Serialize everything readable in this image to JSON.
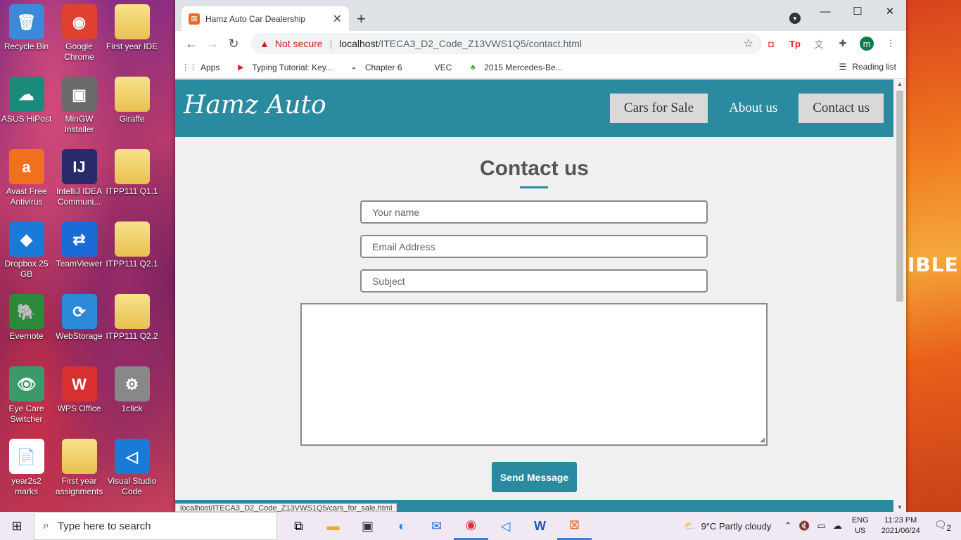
{
  "desktop": {
    "icons": [
      {
        "label": "Recycle Bin",
        "glyph": "🗑"
      },
      {
        "label": "Google Chrome",
        "glyph": "◉"
      },
      {
        "label": "First year IDE",
        "glyph": ""
      },
      {
        "label": "ASUS HiPost",
        "glyph": "☁"
      },
      {
        "label": "MinGW Installer",
        "glyph": "▣"
      },
      {
        "label": "Giraffe",
        "glyph": ""
      },
      {
        "label": "Avast Free Antivirus",
        "glyph": "a"
      },
      {
        "label": "IntelliJ IDEA Communi...",
        "glyph": "IJ"
      },
      {
        "label": "ITPP111 Q1.1",
        "glyph": ""
      },
      {
        "label": "Dropbox 25 GB",
        "glyph": "◆"
      },
      {
        "label": "TeamViewer",
        "glyph": "⇄"
      },
      {
        "label": "ITPP111 Q2.1",
        "glyph": ""
      },
      {
        "label": "Evernote",
        "glyph": "🐘"
      },
      {
        "label": "WebStorage",
        "glyph": "⟳"
      },
      {
        "label": "ITPP111 Q2.2",
        "glyph": ""
      },
      {
        "label": "Eye Care Switcher",
        "glyph": "👁"
      },
      {
        "label": "WPS Office",
        "glyph": "W"
      },
      {
        "label": "1click",
        "glyph": "⚙"
      },
      {
        "label": "year2s2 marks",
        "glyph": "📄"
      },
      {
        "label": "First year assignments",
        "glyph": ""
      },
      {
        "label": "Visual Studio Code",
        "glyph": "◁"
      }
    ],
    "right_text": "IBLE"
  },
  "browser": {
    "tab_title": "Hamz Auto Car Dealership",
    "security_label": "Not secure",
    "url_host": "localhost",
    "url_path": "/ITECA3_D2_Code_Z13VWS1Q5/contact.html",
    "bookmarks": [
      {
        "label": "Apps",
        "icon": "apps-grid-icon"
      },
      {
        "label": "Typing Tutorial: Key...",
        "icon": "youtube-icon"
      },
      {
        "label": "Chapter 6",
        "icon": "python-icon"
      },
      {
        "label": "VEC",
        "icon": ""
      },
      {
        "label": "2015 Mercedes-Be...",
        "icon": "leaf-icon"
      }
    ],
    "reading_list": "Reading list",
    "profile_initial": "m",
    "status_url": "localhost/ITECA3_D2_Code_Z13VWS1Q5/cars_for_sale.html"
  },
  "site": {
    "logo": "Hamz Auto",
    "nav": [
      "Cars for Sale",
      "About us",
      "Contact us"
    ],
    "heading": "Contact us",
    "form": {
      "name_placeholder": "Your name",
      "email_placeholder": "Email Address",
      "subject_placeholder": "Subject",
      "message_value": "",
      "send_label": "Send Message"
    },
    "colors": {
      "accent": "#2a8aa0",
      "nav_box": "#d9d9d9",
      "page_bg": "#f0f0f0"
    }
  },
  "taskbar": {
    "search_placeholder": "Type here to search",
    "weather": "9°C  Partly cloudy",
    "lang_top": "ENG",
    "lang_bottom": "US",
    "time": "11:23 PM",
    "date": "2021/06/24",
    "notification_count": "2"
  }
}
